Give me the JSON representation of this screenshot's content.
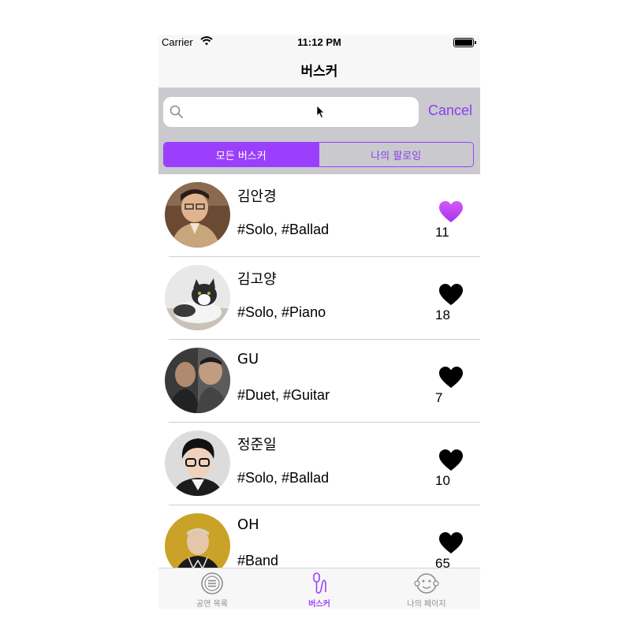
{
  "status_bar": {
    "carrier": "Carrier",
    "time": "11:12 PM"
  },
  "nav": {
    "title": "버스커"
  },
  "search": {
    "placeholder": "",
    "cancel_label": "Cancel"
  },
  "segments": [
    {
      "label": "모든 버스커",
      "selected": true
    },
    {
      "label": "나의 팔로잉",
      "selected": false
    }
  ],
  "buskers": [
    {
      "name": "김안경",
      "tags": "#Solo, #Ballad",
      "likes": "11",
      "liked": true
    },
    {
      "name": "김고양",
      "tags": "#Solo, #Piano",
      "likes": "18",
      "liked": false
    },
    {
      "name": "GU",
      "tags": "#Duet, #Guitar",
      "likes": "7",
      "liked": false
    },
    {
      "name": "정준일",
      "tags": "#Solo, #Ballad",
      "likes": "10",
      "liked": false
    },
    {
      "name": "OH",
      "tags": "#Band",
      "likes": "65",
      "liked": false
    }
  ],
  "tabs": [
    {
      "label": "공연 목록",
      "icon": "list-icon",
      "active": false
    },
    {
      "label": "버스커",
      "icon": "microphone-icon",
      "active": true
    },
    {
      "label": "나의 페이지",
      "icon": "monkey-face-icon",
      "active": false
    }
  ],
  "colors": {
    "accent": "#9b3ffd",
    "liked_heart": "#c944f5",
    "heart": "#000000",
    "search_bg": "#c9c9ce"
  }
}
